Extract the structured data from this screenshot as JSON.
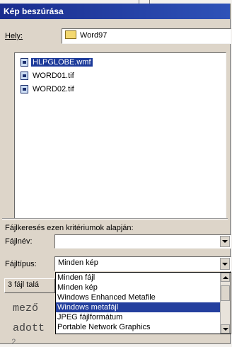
{
  "dialog": {
    "title": "Kép beszúrása",
    "location_label": "Hely:",
    "location_value": "Word97",
    "files": [
      {
        "name": "HLPGLOBE.wmf",
        "selected": true
      },
      {
        "name": "WORD01.tif",
        "selected": false
      },
      {
        "name": "WORD02.tif",
        "selected": false
      }
    ],
    "criteria_label": "Fájlkeresés ezen kritériumok alapján:",
    "filename_label": "Fájlnév:",
    "filename_value": "",
    "filetype_label": "Fájltípus:",
    "filetype_value": "Minden kép",
    "found_text": "3 fájl talá",
    "filetype_options": [
      {
        "label": "Minden fájl",
        "selected": false
      },
      {
        "label": "Minden kép",
        "selected": false
      },
      {
        "label": "Windows Enhanced Metafile",
        "selected": false
      },
      {
        "label": "Windows metafájl",
        "selected": true
      },
      {
        "label": "JPEG fájlformátum",
        "selected": false
      },
      {
        "label": "Portable Network Graphics",
        "selected": false
      }
    ]
  },
  "document": {
    "line1": "mező",
    "line2": "adott",
    "line3": "2"
  },
  "colors": {
    "title_bar": "#1a2d8e",
    "selection": "#243f9e",
    "dialog_face": "#ddd5c9"
  }
}
